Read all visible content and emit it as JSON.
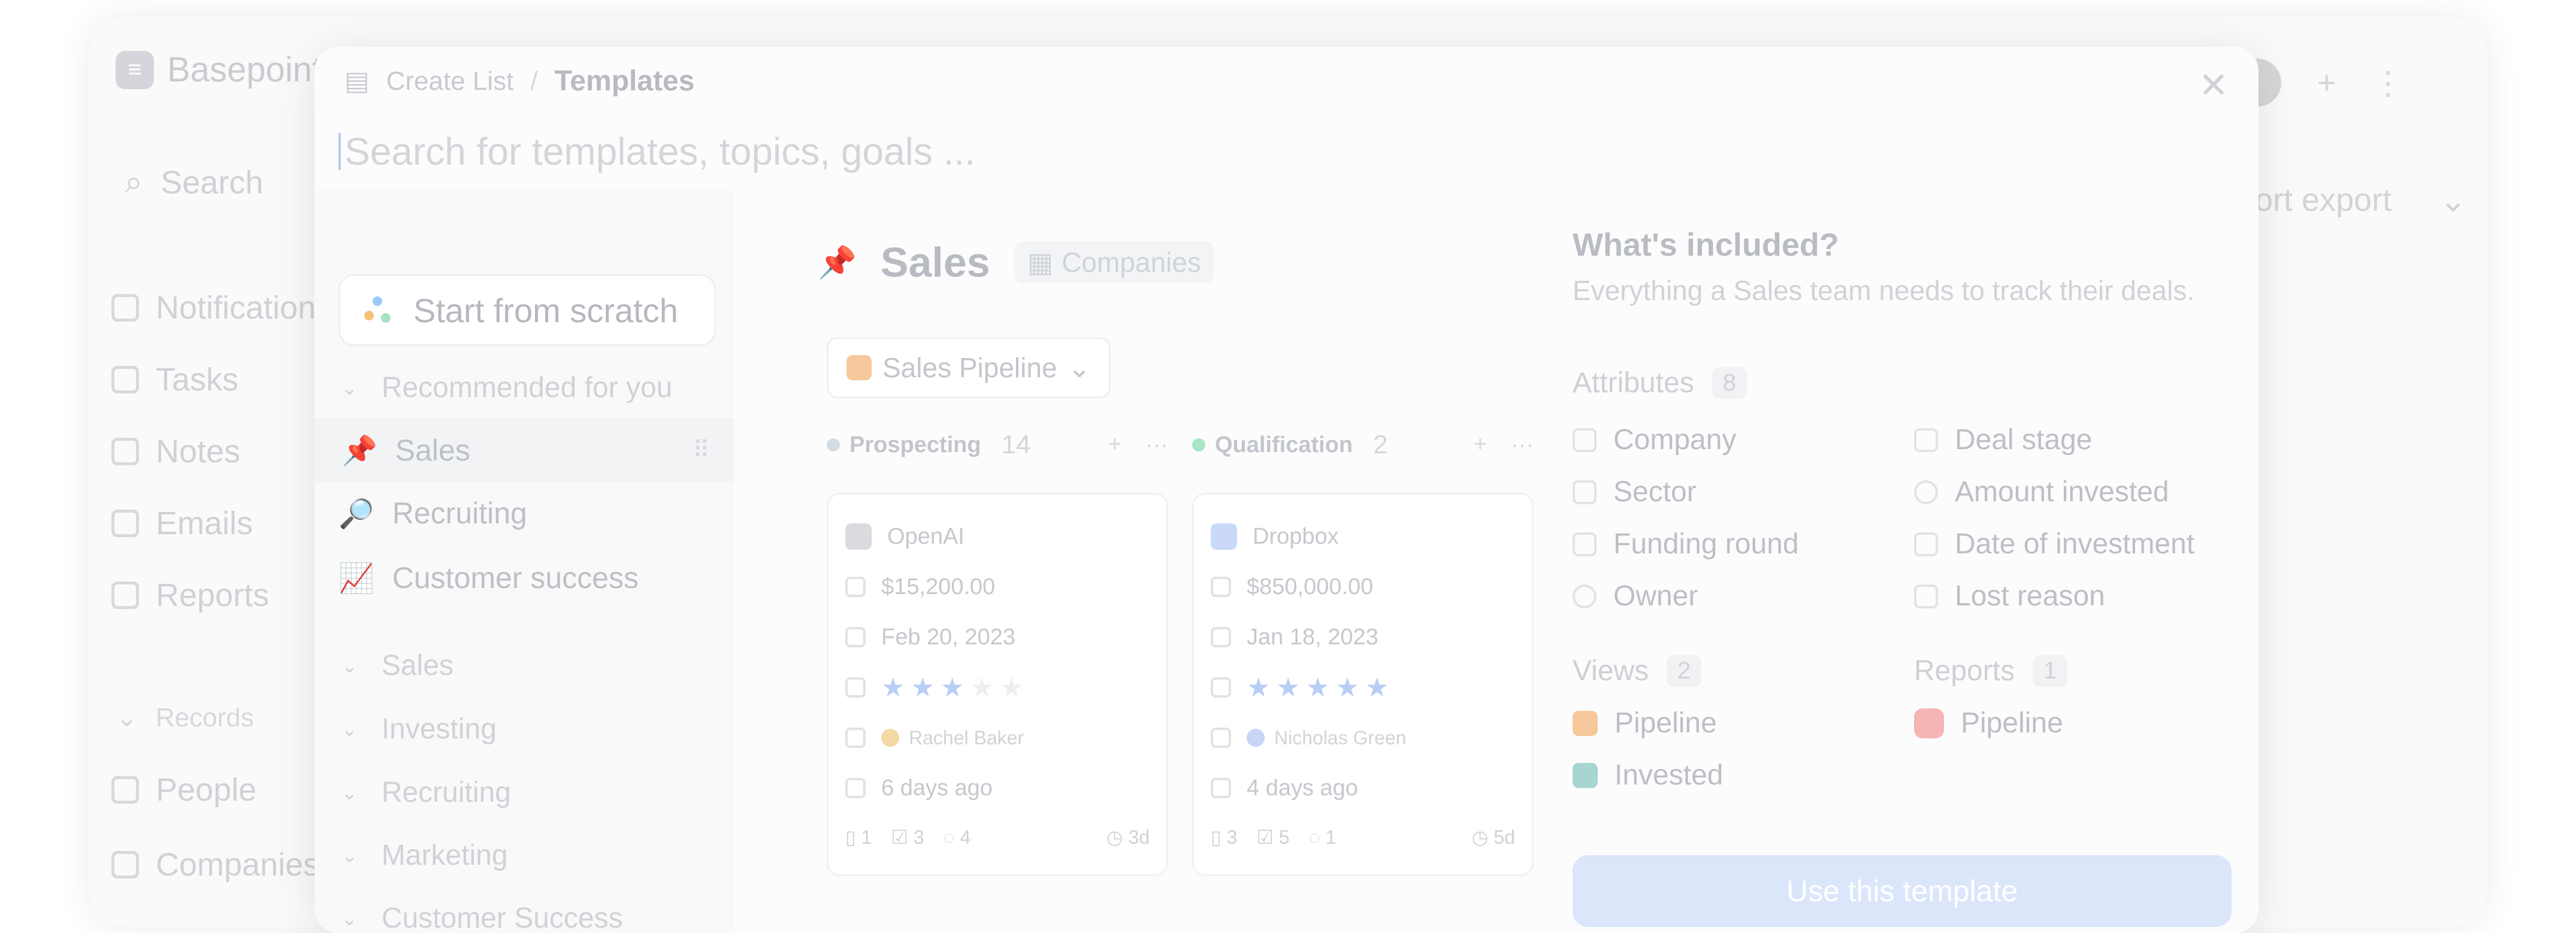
{
  "app": {
    "brand": "Basepoint",
    "search_label": "Search",
    "nav": [
      "Notifications",
      "Tasks",
      "Notes",
      "Emails",
      "Reports"
    ],
    "records_label": "Records",
    "records": [
      "People",
      "Companies"
    ],
    "export_label": "Port export"
  },
  "modal": {
    "breadcrumb_parent": "Create List",
    "breadcrumb_sep": "/",
    "breadcrumb_current": "Templates",
    "search_placeholder": "Search for templates, topics, goals ...",
    "start_scratch": "Start from scratch",
    "recommended_label": "Recommended for you",
    "recommended": [
      {
        "emoji": "📌",
        "label": "Sales",
        "active": true
      },
      {
        "emoji": "🔎",
        "label": "Recruiting",
        "active": false
      },
      {
        "emoji": "📈",
        "label": "Customer success",
        "active": false
      }
    ],
    "groups": [
      "Sales",
      "Investing",
      "Recruiting",
      "Marketing",
      "Customer Success"
    ]
  },
  "preview": {
    "emoji": "📌",
    "title": "Sales",
    "object_chip": "Companies",
    "view_name": "Sales Pipeline",
    "columns": [
      {
        "name": "Prospecting",
        "count": "14",
        "color": "#d5dbe3",
        "card": {
          "company": "OpenAI",
          "amount": "$15,200.00",
          "date": "Feb 20, 2023",
          "rating": 3,
          "owner": "Rachel Baker",
          "last": "6 days ago",
          "files": "1",
          "tasks": "3",
          "comments": "4",
          "age": "3d"
        }
      },
      {
        "name": "Qualification",
        "count": "2",
        "color": "#a8e6c8",
        "card": {
          "company": "Dropbox",
          "amount": "$850,000.00",
          "date": "Jan 18, 2023",
          "rating": 5,
          "owner": "Nicholas Green",
          "last": "4 days ago",
          "files": "3",
          "tasks": "5",
          "comments": "1",
          "age": "5d"
        }
      }
    ]
  },
  "details": {
    "title": "What's included?",
    "subtitle": "Everything a Sales team needs to track their deals.",
    "attributes_label": "Attributes",
    "attributes_count": "8",
    "attributes": [
      "Company",
      "Deal stage",
      "Sector",
      "Amount invested",
      "Funding round",
      "Date of investment",
      "Owner",
      "Lost reason"
    ],
    "views_label": "Views",
    "views_count": "2",
    "views": [
      "Pipeline",
      "Invested"
    ],
    "reports_label": "Reports",
    "reports_count": "1",
    "reports": [
      "Pipeline"
    ],
    "cta": "Use this template"
  },
  "colors": {
    "accent": "#dbe6fb",
    "pipeline_icon": "#f6c89b",
    "invested_icon": "#a7d5d0",
    "report_icon": "#f5b5b5"
  }
}
